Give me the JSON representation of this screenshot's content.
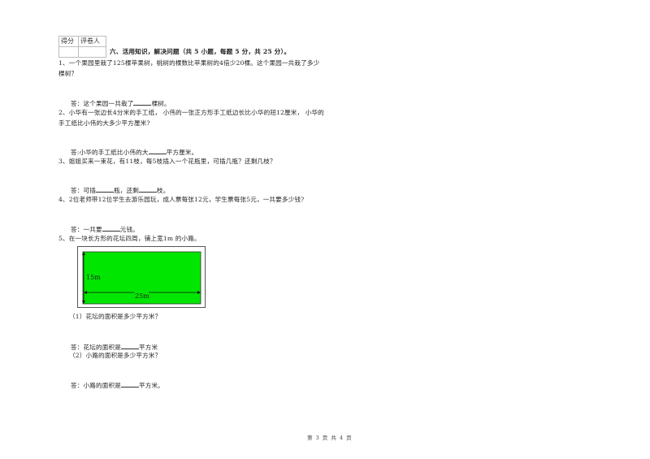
{
  "score_box": {
    "headers": [
      "得分",
      "评卷人"
    ]
  },
  "section": {
    "title": "六、活用知识，解决问题（共 5 小题，每题 5 分，共 25 分）。"
  },
  "questions": [
    {
      "lines": [
        "1、一个果园里栽了125棵苹果树，桃树的棵数比苹果树的4倍少20棵。这个果园一共栽了多少",
        "棵树？"
      ],
      "answer": {
        "prefix": "答：这个果园一共栽了",
        "suffix": "棵树。"
      }
    },
    {
      "lines": [
        "2、小华有一张边长4分米的手工纸， 小伟的一张正方形手工纸边长比小华的短12厘米， 小华的",
        "手工纸比小伟的大多少平方厘米?"
      ],
      "answer": {
        "prefix": "答:小华的手工纸比小伟的大",
        "suffix": "平方厘米。"
      }
    },
    {
      "lines": [
        "3、姐姐买来一束花，有11枝，每5枝插入一个花瓶里，可插几瓶？还剩几枝？"
      ],
      "answer": {
        "prefix": "答：可插",
        "middle": "瓶，还剩",
        "suffix": "枝。"
      }
    },
    {
      "lines": [
        "4、2位老师带12位学生去游乐园玩，成人票每张12元，学生票每张5元，一共要多少钱?"
      ],
      "answer": {
        "prefix": "答：一共要",
        "suffix": "元钱。"
      }
    },
    {
      "lines": [
        "5、在一块长方形的花坛四周，铺上宽1m 的小路。"
      ],
      "diagram": {
        "height_label": "15m",
        "width_label": "25m",
        "fill_color": "#00e600"
      },
      "subquestions": [
        {
          "text": "（1）花坛的面积是多少平方米？",
          "answer": {
            "prefix": "答：花坛的面积是",
            "suffix": "平方米"
          }
        },
        {
          "text": "（2）小路的面积是多少平方米？",
          "answer": {
            "prefix": "答：小路的面积是",
            "suffix": "平方米。"
          }
        }
      ]
    }
  ],
  "footer": {
    "page_text": "第 3 页 共 4 页"
  }
}
